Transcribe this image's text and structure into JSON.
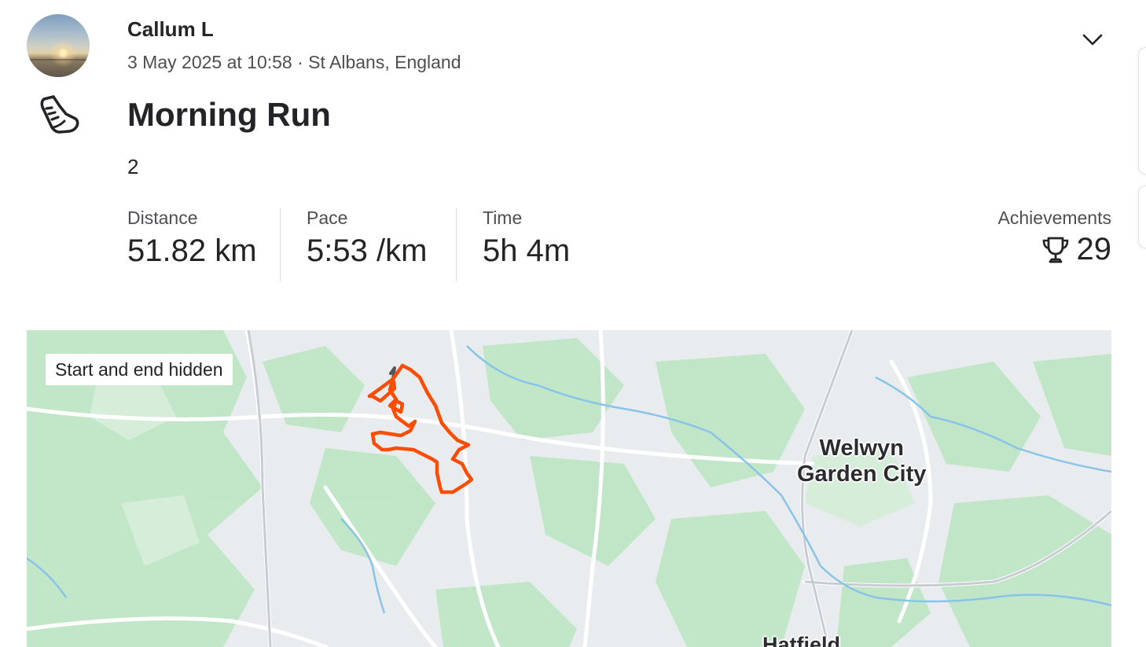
{
  "header": {
    "athlete_name": "Callum L",
    "meta": "3 May 2025 at 10:58 · St Albans, England"
  },
  "activity": {
    "icon": "running-shoe-icon",
    "title": "Morning Run",
    "description": "2"
  },
  "stats": [
    {
      "label": "Distance",
      "value": "51.82 km"
    },
    {
      "label": "Pace",
      "value": "5:53 /km"
    },
    {
      "label": "Time",
      "value": "5h 4m"
    }
  ],
  "achievements": {
    "label": "Achievements",
    "icon": "trophy-icon",
    "count": "29"
  },
  "map": {
    "privacy_badge": "Start and end hidden",
    "places": [
      "Welwyn",
      "Garden City",
      "Hatfield"
    ],
    "route_color": "#fc4c02",
    "hidden_segment_color": "#555555"
  },
  "colors": {
    "text": "#242428",
    "muted": "#4e4e55",
    "map_green": "#b9e4bf",
    "map_water": "#88c4e8"
  }
}
